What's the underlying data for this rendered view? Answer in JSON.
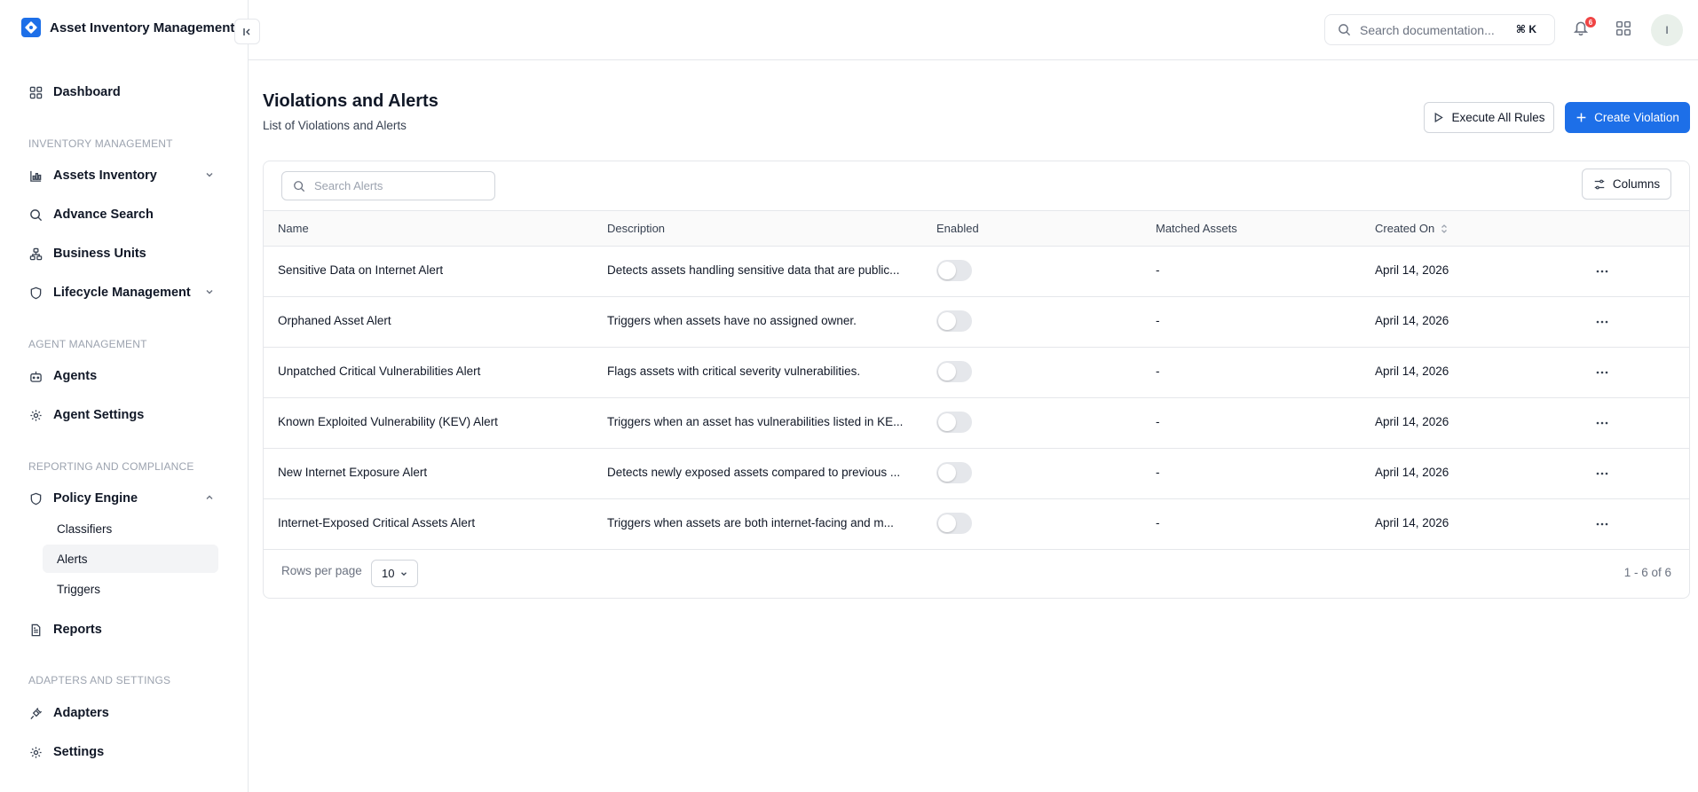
{
  "brand": {
    "title": "Asset Inventory Management"
  },
  "sidebar": {
    "dashboard": "Dashboard",
    "sections": {
      "inventory": "INVENTORY MANAGEMENT",
      "agent": "AGENT MANAGEMENT",
      "reporting": "REPORTING AND COMPLIANCE",
      "adapters": "ADAPTERS AND SETTINGS"
    },
    "items": {
      "assets_inventory": "Assets Inventory",
      "advance_search": "Advance Search",
      "business_units": "Business Units",
      "lifecycle_management": "Lifecycle Management",
      "agents": "Agents",
      "agent_settings": "Agent Settings",
      "policy_engine": "Policy Engine",
      "reports": "Reports",
      "adapters": "Adapters",
      "settings": "Settings"
    },
    "policy_sub": {
      "classifiers": "Classifiers",
      "alerts": "Alerts",
      "triggers": "Triggers"
    }
  },
  "topbar": {
    "search_placeholder": "Search documentation...",
    "shortcut": "⌘ K",
    "notification_count": "6",
    "avatar_initial": "I"
  },
  "header": {
    "title": "Violations and Alerts",
    "subtitle": "List of Violations and Alerts",
    "execute_label": "Execute All Rules",
    "create_label": "Create Violation"
  },
  "table": {
    "search_placeholder": "Search Alerts",
    "columns_label": "Columns",
    "headers": {
      "name": "Name",
      "description": "Description",
      "enabled": "Enabled",
      "matched": "Matched Assets",
      "created": "Created On"
    },
    "rows": [
      {
        "name": "Sensitive Data on Internet Alert",
        "description": "Detects assets handling sensitive data that are public...",
        "enabled": false,
        "matched": "-",
        "created": "April 14, 2026"
      },
      {
        "name": "Orphaned Asset Alert",
        "description": "Triggers when assets have no assigned owner.",
        "enabled": false,
        "matched": "-",
        "created": "April 14, 2026"
      },
      {
        "name": "Unpatched Critical Vulnerabilities Alert",
        "description": "Flags assets with critical severity vulnerabilities.",
        "enabled": false,
        "matched": "-",
        "created": "April 14, 2026"
      },
      {
        "name": "Known Exploited Vulnerability (KEV) Alert",
        "description": "Triggers when an asset has vulnerabilities listed in KE...",
        "enabled": false,
        "matched": "-",
        "created": "April 14, 2026"
      },
      {
        "name": "New Internet Exposure Alert",
        "description": "Detects newly exposed assets compared to previous ...",
        "enabled": false,
        "matched": "-",
        "created": "April 14, 2026"
      },
      {
        "name": "Internet-Exposed Critical Assets Alert",
        "description": "Triggers when assets are both internet-facing and m...",
        "enabled": false,
        "matched": "-",
        "created": "April 14, 2026"
      }
    ],
    "rows_per_page_label": "Rows per page",
    "rows_per_page_value": "10",
    "pagination": "1 - 6 of 6"
  },
  "colors": {
    "accent": "#1d6fe8",
    "badge": "#ef4444"
  }
}
